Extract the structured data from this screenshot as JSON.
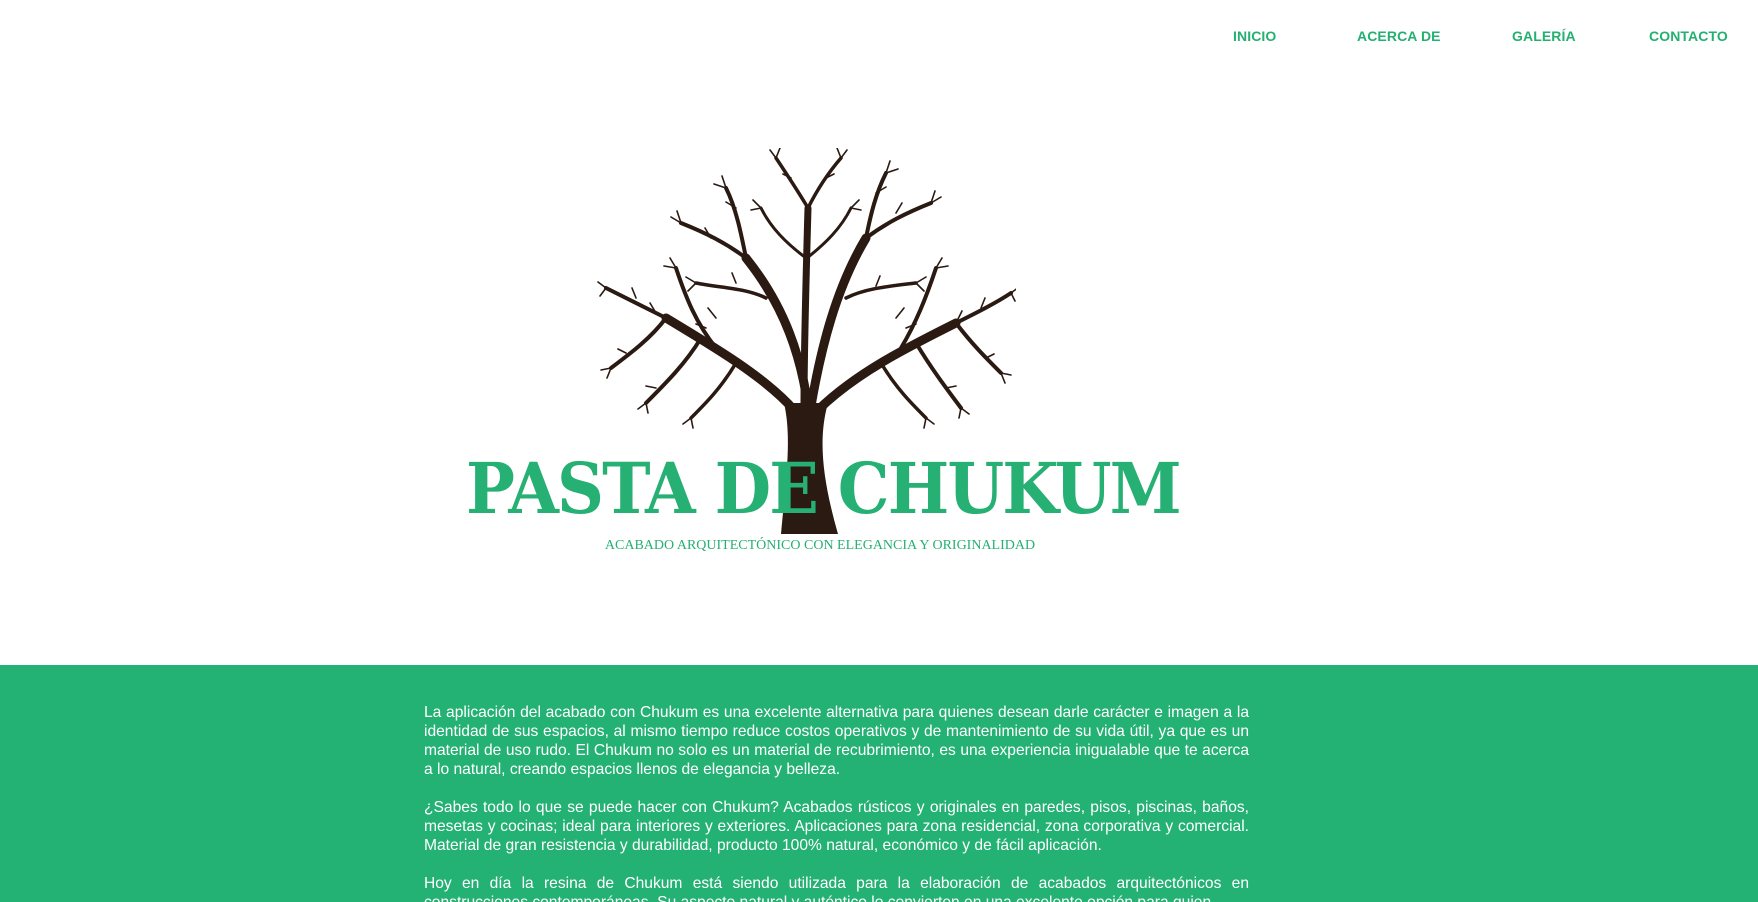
{
  "nav": {
    "items": [
      {
        "label": "INICIO"
      },
      {
        "label": "ACERCA DE"
      },
      {
        "label": "GALERÍA"
      },
      {
        "label": "CONTACTO"
      }
    ],
    "color": "#24b070"
  },
  "hero": {
    "logo_icon": "tree-icon",
    "title": "PASTA DE CHUKUM",
    "tagline": "ACABADO ARQUITECTÓNICO CON ELEGANCIA Y ORIGINALIDAD",
    "brand_color": "#27b074",
    "tree_color": "#2a1a12"
  },
  "content": {
    "background": "#24b174",
    "paragraphs": [
      "La aplicación del acabado con Chukum es una excelente alternativa para quienes desean darle carácter e imagen a la identidad de sus espacios, al mismo tiempo reduce costos operativos y de mantenimiento de su vida útil, ya que es un material de uso rudo. El Chukum no solo es un material de recubrimiento, es una experiencia inigualable que te acerca a lo natural, creando espacios llenos de elegancia y belleza.",
      "¿Sabes todo lo que se puede hacer con Chukum? Acabados rústicos y originales en paredes, pisos, piscinas, baños, mesetas y cocinas; ideal para interiores y exteriores. Aplicaciones para zona residencial, zona corporativa y comercial. Material de gran resistencia y durabilidad, producto 100% natural, económico y de fácil aplicación.",
      "Hoy en día la resina de Chukum está siendo utilizada para la elaboración de acabados arquitectónicos en construcciones contemporáneas. Su aspecto natural y auténtico lo convierten en una excelente opción para quien"
    ]
  }
}
